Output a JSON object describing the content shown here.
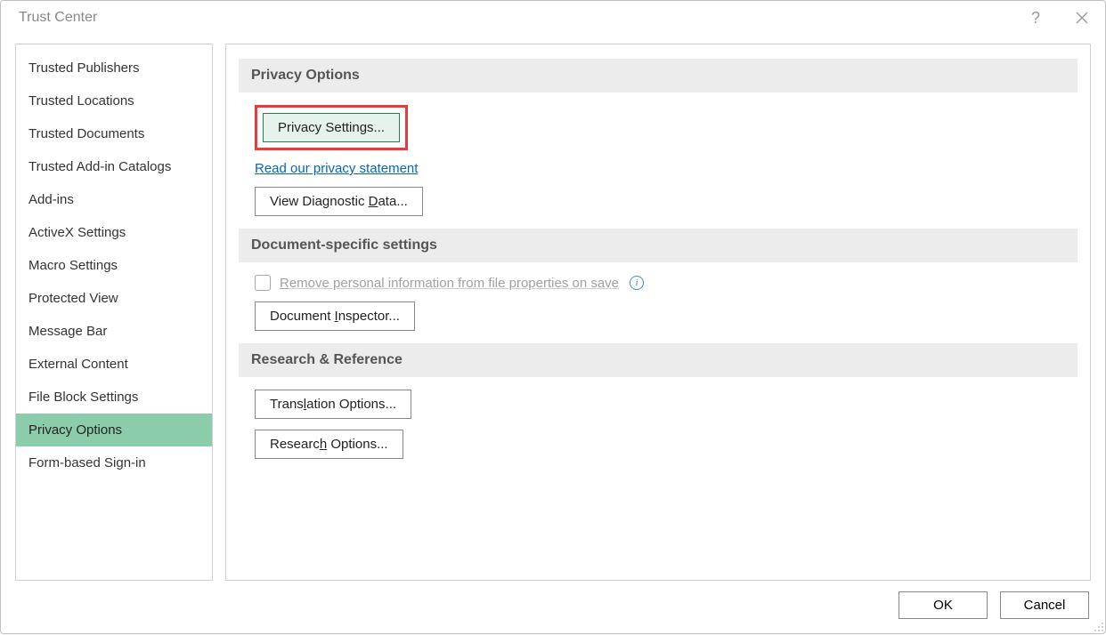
{
  "dialog": {
    "title": "Trust Center"
  },
  "sidebar": {
    "items": [
      {
        "label": "Trusted Publishers"
      },
      {
        "label": "Trusted Locations"
      },
      {
        "label": "Trusted Documents"
      },
      {
        "label": "Trusted Add-in Catalogs"
      },
      {
        "label": "Add-ins"
      },
      {
        "label": "ActiveX Settings"
      },
      {
        "label": "Macro Settings"
      },
      {
        "label": "Protected View"
      },
      {
        "label": "Message Bar"
      },
      {
        "label": "External Content"
      },
      {
        "label": "File Block Settings"
      },
      {
        "label": "Privacy Options"
      },
      {
        "label": "Form-based Sign-in"
      }
    ],
    "selected_index": 11
  },
  "sections": {
    "privacy_options": {
      "header": "Privacy Options",
      "privacy_settings_btn": "Privacy Settings...",
      "privacy_statement_link": "Read our privacy statement",
      "diagnostic_pre": "View Diagnostic ",
      "diagnostic_u": "D",
      "diagnostic_post": "ata..."
    },
    "document_specific": {
      "header": "Document-specific settings",
      "remove_pre": "",
      "remove_u": "R",
      "remove_post": "emove personal information from file properties on save",
      "inspector_pre": "Document ",
      "inspector_u": "I",
      "inspector_post": "nspector..."
    },
    "research": {
      "header": "Research & Reference",
      "translation_pre": "Trans",
      "translation_u": "l",
      "translation_post": "ation Options...",
      "research_pre": "Researc",
      "research_u": "h",
      "research_post": " Options..."
    }
  },
  "footer": {
    "ok": "OK",
    "cancel": "Cancel"
  }
}
